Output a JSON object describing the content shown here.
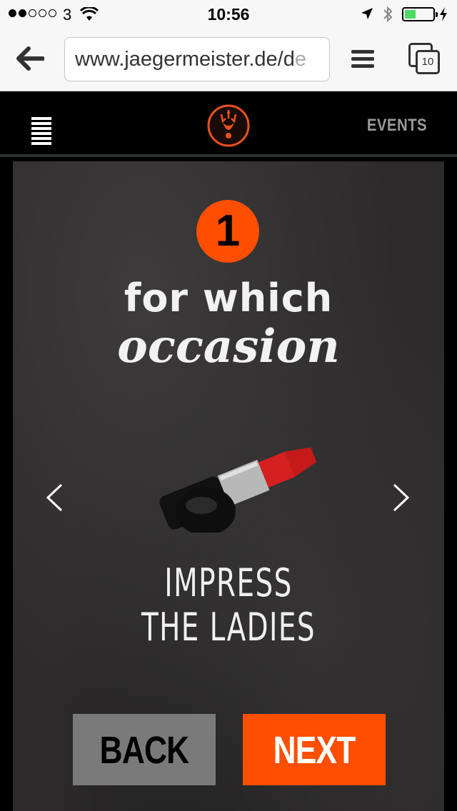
{
  "status_bar": {
    "carrier": "3",
    "time": "10:56",
    "battery_level": 0.4,
    "signal_bars": 2,
    "colors": {
      "battery": "#4cd964"
    }
  },
  "browser": {
    "url": "www.jaegermeister.de/d",
    "url_faded": "e",
    "tab_count": "10"
  },
  "site_header": {
    "events_label": "EVENTS",
    "colors": {
      "logo": "#e8521c"
    }
  },
  "quiz": {
    "step_number": "1",
    "question_line1": "for which",
    "question_line2": "occasion",
    "answer_line1": "IMPRESS",
    "answer_line2": "THE LADIES",
    "back_label": "BACK",
    "next_label": "NEXT",
    "colors": {
      "accent": "#fe4e00",
      "back_button": "#7a7a7a"
    }
  }
}
